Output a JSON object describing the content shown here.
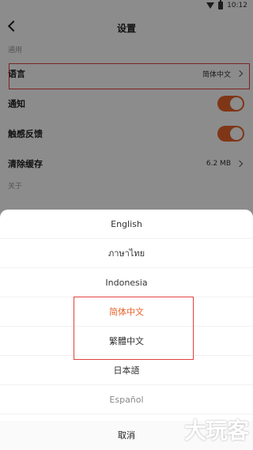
{
  "status_bar": {
    "time": "10:12"
  },
  "header": {
    "title": "设置"
  },
  "sections": {
    "general_label": "通用",
    "about_label": "关于"
  },
  "settings": {
    "language": {
      "label": "语言",
      "value": "简体中文"
    },
    "notifications": {
      "label": "通知",
      "enabled": true
    },
    "haptic": {
      "label": "触感反馈",
      "enabled": true
    },
    "cache": {
      "label": "清除缓存",
      "value": "6.2 MB"
    }
  },
  "language_sheet": {
    "options": [
      "English",
      "ภาษาไทย",
      "Indonesia",
      "简体中文",
      "繁體中文",
      "日本語",
      "Español"
    ],
    "selected": "简体中文",
    "cancel_label": "取消"
  },
  "watermark": {
    "text": "大玩客"
  },
  "colors": {
    "accent": "#e8632b",
    "highlight": "#e24141"
  }
}
